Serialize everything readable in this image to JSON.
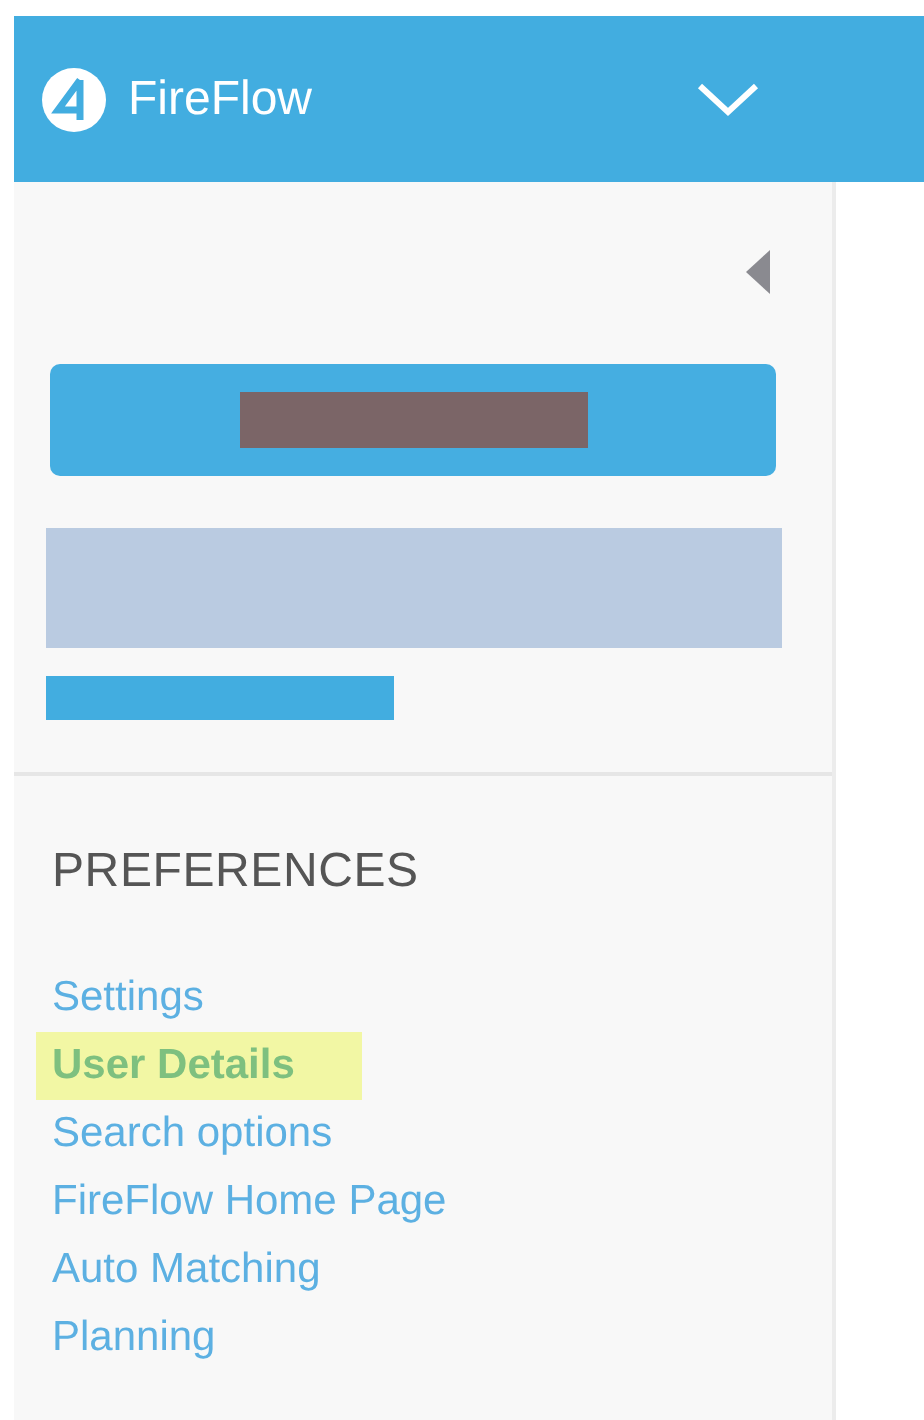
{
  "header": {
    "app_name": "FireFlow"
  },
  "preferences": {
    "title": "PREFERENCES",
    "items": [
      {
        "label": "Settings",
        "selected": false
      },
      {
        "label": "User Details",
        "selected": true
      },
      {
        "label": "Search options",
        "selected": false
      },
      {
        "label": "FireFlow Home Page",
        "selected": false
      },
      {
        "label": "Auto Matching",
        "selected": false
      },
      {
        "label": "Planning",
        "selected": false
      }
    ]
  }
}
